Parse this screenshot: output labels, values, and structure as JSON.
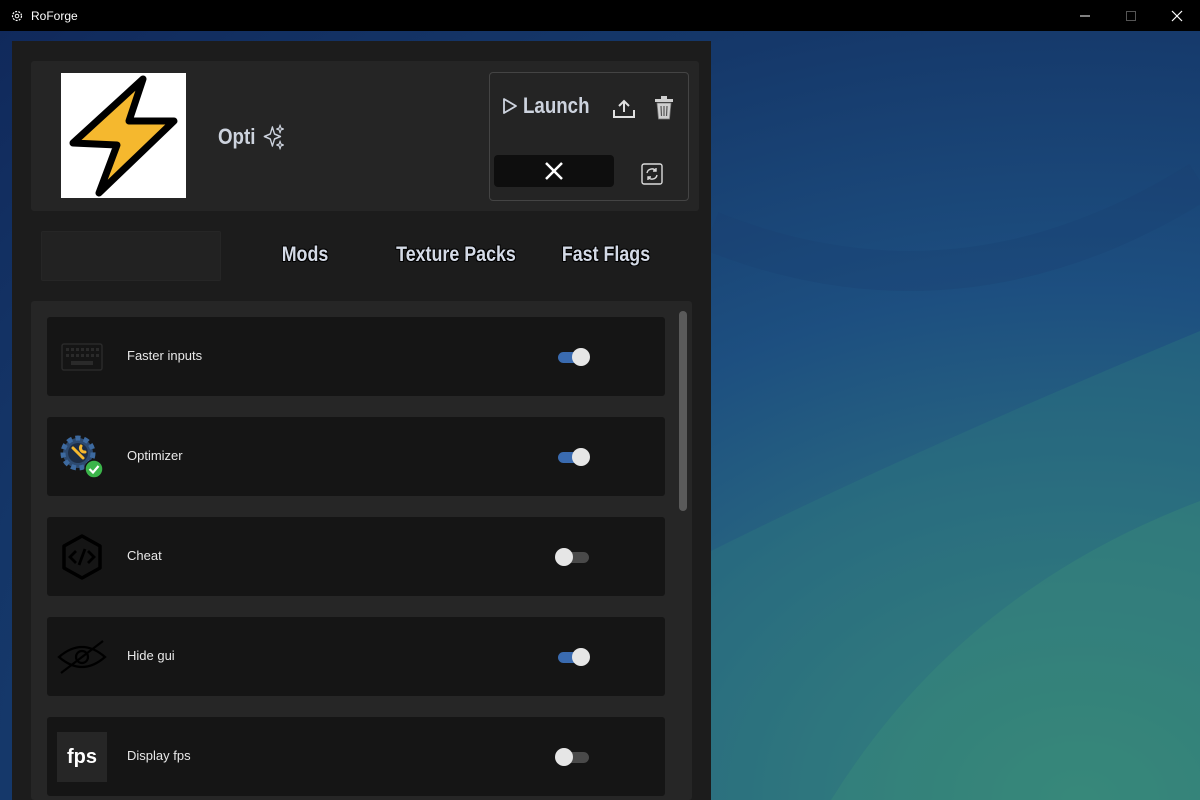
{
  "window": {
    "title": "RoForge",
    "controls": [
      "minimize",
      "maximize",
      "close"
    ]
  },
  "profile": {
    "name": "Opti",
    "logo_icon": "lightning-bolt-icon",
    "name_icon": "sparkles-icon"
  },
  "launcher": {
    "launch_label": "Launch",
    "launch_icon": "play-icon",
    "export_icon": "upload-icon",
    "delete_icon": "trash-icon",
    "cancel_icon": "close-icon",
    "refresh_icon": "refresh-icon"
  },
  "tabs": [
    {
      "label": ""
    },
    {
      "label": "Mods"
    },
    {
      "label": "Texture Packs"
    },
    {
      "label": "Fast Flags"
    }
  ],
  "mods": [
    {
      "label": "Faster inputs",
      "icon": "keyboard-icon",
      "enabled": true
    },
    {
      "label": "Optimizer",
      "icon": "gear-wrench-check-icon",
      "enabled": true
    },
    {
      "label": "Cheat",
      "icon": "code-hexagon-icon",
      "enabled": false
    },
    {
      "label": "Hide gui",
      "icon": "eye-slash-icon",
      "enabled": true
    },
    {
      "label": "Display fps",
      "icon": "fps-icon",
      "icon_text": "fps",
      "enabled": false
    }
  ],
  "colors": {
    "toggle_on": "#3a6bb0",
    "toggle_off": "#4a4a4a",
    "bolt": "#f5b82e"
  }
}
